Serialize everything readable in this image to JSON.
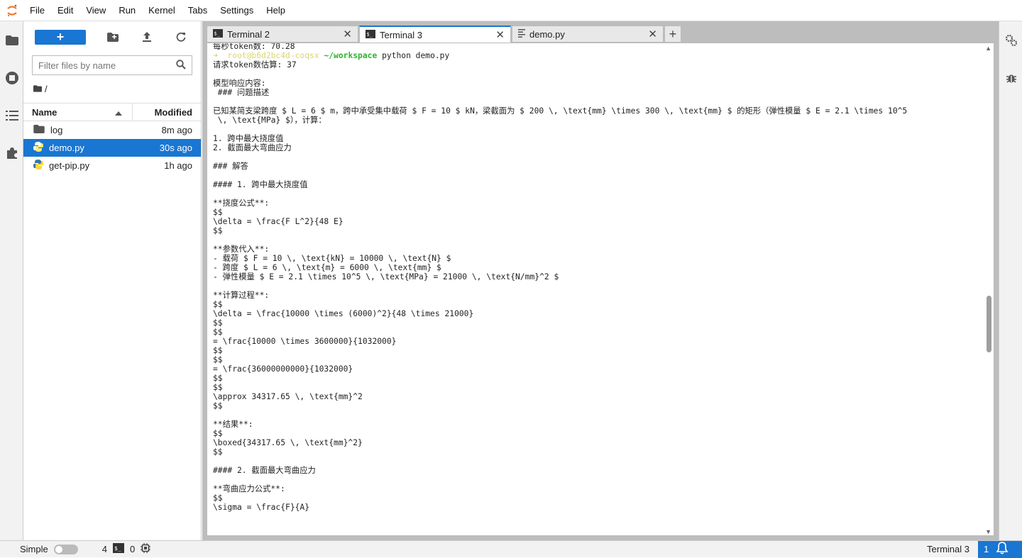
{
  "menu": [
    "File",
    "Edit",
    "View",
    "Run",
    "Kernel",
    "Tabs",
    "Settings",
    "Help"
  ],
  "filebrowser": {
    "filter_placeholder": "Filter files by name",
    "breadcrumb": "/",
    "col_name": "Name",
    "col_modified": "Modified",
    "files": [
      {
        "name": "log",
        "modified": "8m ago",
        "type": "folder",
        "selected": false
      },
      {
        "name": "demo.py",
        "modified": "30s ago",
        "type": "python",
        "selected": true
      },
      {
        "name": "get-pip.py",
        "modified": "1h ago",
        "type": "python",
        "selected": false
      }
    ]
  },
  "tabs": [
    {
      "label": "Terminal 2",
      "type": "terminal",
      "active": false
    },
    {
      "label": "Terminal 3",
      "type": "terminal",
      "active": true
    },
    {
      "label": "demo.py",
      "type": "file",
      "active": false
    }
  ],
  "terminal": {
    "line0": "每秒token数: 70.28",
    "prompt_user": "➜  root@b6d2bc4d-coqsx ",
    "prompt_path": "~/workspace",
    "prompt_cmd": " python demo.py",
    "body": "请求token数估算: 37\n\n模型响应内容:\n ### 问题描述\n\n已知某简支梁跨度 $ L = 6 $ m，跨中承受集中载荷 $ F = 10 $ kN，梁截面为 $ 200 \\, \\text{mm} \\times 300 \\, \\text{mm} $ 的矩形（弹性模量 $ E = 2.1 \\times 10^5\n \\, \\text{MPa} $），计算：\n\n1. 跨中最大挠度值\n2. 截面最大弯曲应力\n\n### 解答\n\n#### 1. 跨中最大挠度值\n\n**挠度公式**:\n$$\n\\delta = \\frac{F L^2}{48 E}\n$$\n\n**参数代入**:\n- 载荷 $ F = 10 \\, \\text{kN} = 10000 \\, \\text{N} $\n- 跨度 $ L = 6 \\, \\text{m} = 6000 \\, \\text{mm} $\n- 弹性模量 $ E = 2.1 \\times 10^5 \\, \\text{MPa} = 21000 \\, \\text{N/mm}^2 $\n\n**计算过程**:\n$$\n\\delta = \\frac{10000 \\times (6000)^2}{48 \\times 21000}\n$$\n$$\n= \\frac{10000 \\times 3600000}{1032000}\n$$\n$$\n= \\frac{36000000000}{1032000}\n$$\n$$\n\\approx 34317.65 \\, \\text{mm}^2\n$$\n\n**结果**:\n$$\n\\boxed{34317.65 \\, \\text{mm}^2}\n$$\n\n#### 2. 截面最大弯曲应力\n\n**弯曲应力公式**:\n$$\n\\sigma = \\frac{F}{A}"
  },
  "statusbar": {
    "mode": "Simple",
    "terminals_count": "4",
    "kernels_count": "0",
    "activity": "Terminal 3",
    "notifications": "1"
  },
  "colors": {
    "accent": "#1976d2",
    "logo": "#f37726"
  }
}
